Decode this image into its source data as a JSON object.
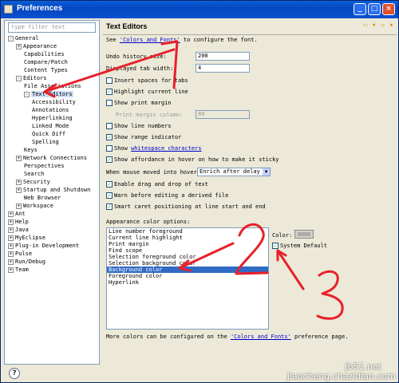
{
  "window": {
    "title": "Preferences"
  },
  "left": {
    "filter_placeholder": "type filter text",
    "tree": [
      {
        "label": "General",
        "indent": 0,
        "toggle": "-"
      },
      {
        "label": "Appearance",
        "indent": 1,
        "toggle": "+"
      },
      {
        "label": "Capabilities",
        "indent": 2,
        "toggle": ""
      },
      {
        "label": "Compare/Patch",
        "indent": 2,
        "toggle": ""
      },
      {
        "label": "Content Types",
        "indent": 2,
        "toggle": ""
      },
      {
        "label": "Editors",
        "indent": 1,
        "toggle": "-"
      },
      {
        "label": "File Associations",
        "indent": 2,
        "toggle": ""
      },
      {
        "label": "Text Editors",
        "indent": 2,
        "toggle": "-",
        "selected": true
      },
      {
        "label": "Accessibility",
        "indent": 3,
        "toggle": ""
      },
      {
        "label": "Annotations",
        "indent": 3,
        "toggle": ""
      },
      {
        "label": "Hyperlinking",
        "indent": 3,
        "toggle": ""
      },
      {
        "label": "Linked Mode",
        "indent": 3,
        "toggle": ""
      },
      {
        "label": "Quick Diff",
        "indent": 3,
        "toggle": ""
      },
      {
        "label": "Spelling",
        "indent": 3,
        "toggle": ""
      },
      {
        "label": "Keys",
        "indent": 2,
        "toggle": ""
      },
      {
        "label": "Network Connections",
        "indent": 1,
        "toggle": "+"
      },
      {
        "label": "Perspectives",
        "indent": 2,
        "toggle": ""
      },
      {
        "label": "Search",
        "indent": 2,
        "toggle": ""
      },
      {
        "label": "Security",
        "indent": 1,
        "toggle": "+"
      },
      {
        "label": "Startup and Shutdown",
        "indent": 1,
        "toggle": "+"
      },
      {
        "label": "Web Browser",
        "indent": 2,
        "toggle": ""
      },
      {
        "label": "Workspace",
        "indent": 1,
        "toggle": "+"
      },
      {
        "label": "Ant",
        "indent": 0,
        "toggle": "+"
      },
      {
        "label": "Help",
        "indent": 0,
        "toggle": "+"
      },
      {
        "label": "Java",
        "indent": 0,
        "toggle": "+"
      },
      {
        "label": "MyEclipse",
        "indent": 0,
        "toggle": "+"
      },
      {
        "label": "Plug-in Development",
        "indent": 0,
        "toggle": "+"
      },
      {
        "label": "Pulse",
        "indent": 0,
        "toggle": "+"
      },
      {
        "label": "Run/Debug",
        "indent": 0,
        "toggle": "+"
      },
      {
        "label": "Team",
        "indent": 0,
        "toggle": "+"
      }
    ]
  },
  "right": {
    "header": "Text Editors",
    "see_prefix": "See ",
    "see_link": "'Colors and Fonts'",
    "see_suffix": " to configure the font.",
    "undo_label": "Undo history size:",
    "undo_value": "200",
    "tab_label": "Displayed tab width:",
    "tab_value": "4",
    "insert_spaces": "Insert spaces for tabs",
    "highlight_line": "Highlight current line",
    "show_print_margin": "Show print margin",
    "print_margin_col_label": "Print margin column:",
    "print_margin_col_value": "80",
    "show_line_numbers": "Show line numbers",
    "show_range": "Show range indicator",
    "show_ws_prefix": "Show ",
    "show_ws_link": "whitespace characters",
    "show_affordance": "Show affordance in hover on how to make it sticky",
    "mouse_label": "When mouse moved into hover:",
    "mouse_value": "Enrich after delay",
    "enable_dnd": "Enable drag and drop of text",
    "warn_derived": "Warn before editing a derived file",
    "smart_caret": "Smart caret positioning at line start and end",
    "appearance_label": "Appearance color options:",
    "color_items": [
      "Line number foreground",
      "Current line highlight",
      "Print margin",
      "Find scope",
      "Selection foreground color",
      "Selection background color",
      "Background color",
      "Foreground color",
      "Hyperlink"
    ],
    "selected_color_item": "Background color",
    "color_label": "Color:",
    "system_default": "System Default",
    "more_prefix": "More colors can be configured on the ",
    "more_link": "'Colors and Fonts'",
    "more_suffix": " preference page."
  },
  "annotations": {
    "n1": "1",
    "n2": "2",
    "n3": "3",
    "annotation_color": "#e8202a"
  },
  "watermark": {
    "line1": "jb51.net",
    "line2": "jiaocheng.chazidian.com"
  }
}
